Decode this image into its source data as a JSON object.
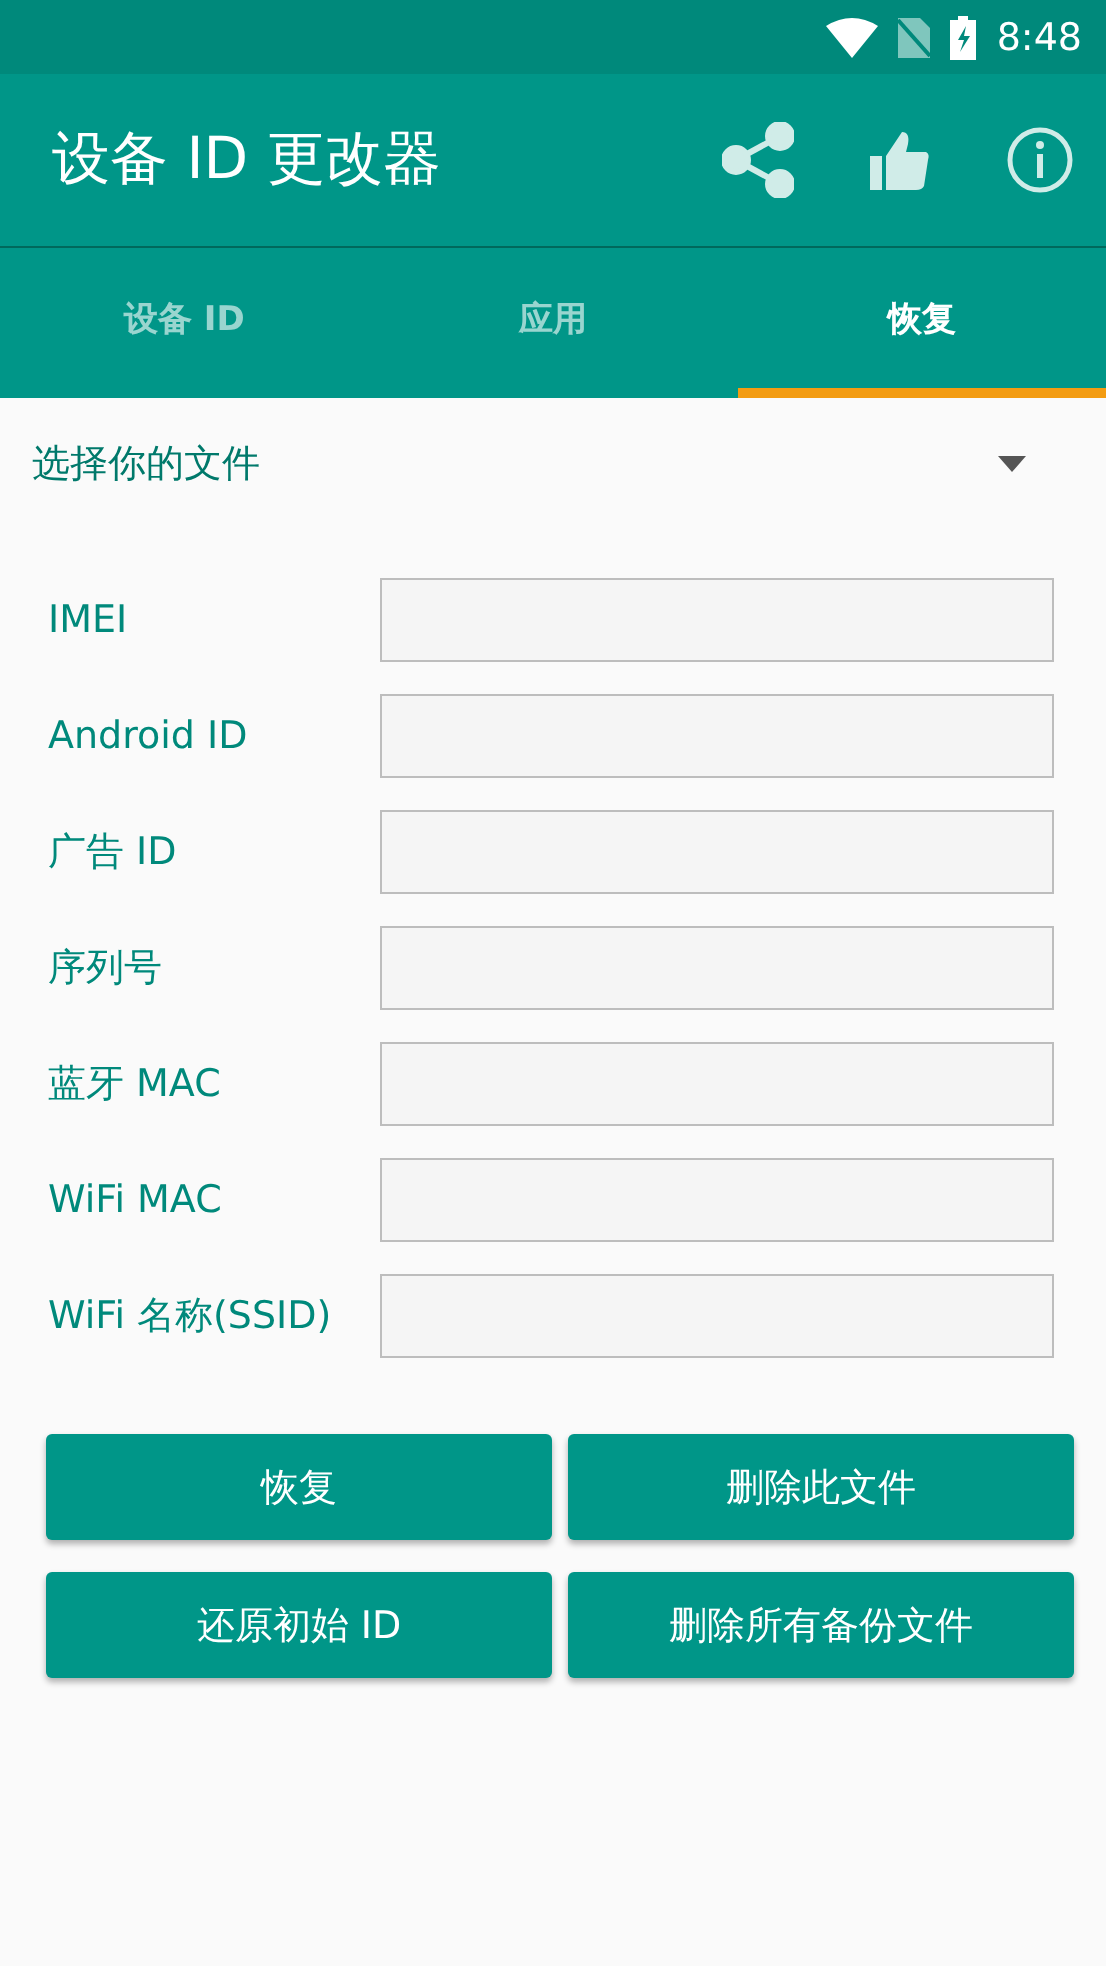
{
  "status_bar": {
    "time": "8:48"
  },
  "app_bar": {
    "title": "设备 ID 更改器"
  },
  "tabs": [
    {
      "label": "设备 ID",
      "selected": false
    },
    {
      "label": "应用",
      "selected": false
    },
    {
      "label": "恢复",
      "selected": true
    }
  ],
  "file_picker": {
    "value": "选择你的文件"
  },
  "fields": [
    {
      "label": "IMEI"
    },
    {
      "label": "Android ID"
    },
    {
      "label": "广告 ID"
    },
    {
      "label": "序列号"
    },
    {
      "label": "蓝牙 MAC"
    },
    {
      "label": "WiFi MAC"
    },
    {
      "label": "WiFi 名称(SSID)"
    }
  ],
  "buttons": [
    {
      "label": "恢复"
    },
    {
      "label": "删除此文件"
    },
    {
      "label": "还原初始 ID"
    },
    {
      "label": "删除所有备份文件"
    }
  ]
}
